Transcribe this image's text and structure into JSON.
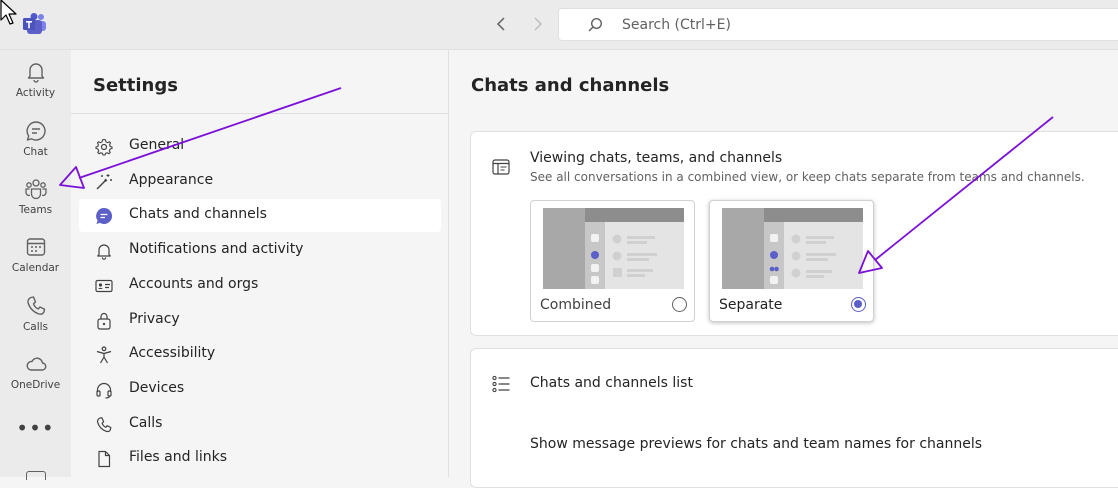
{
  "colors": {
    "accent": "#5b5fc7",
    "annotation": "#7b10d8",
    "rail_bg": "#ebebeb",
    "panel_bg": "#f5f5f5"
  },
  "topbar": {
    "logo_icon": "teams-logo-icon",
    "back_icon": "chevron-left-icon",
    "forward_icon": "chevron-right-icon",
    "search_placeholder": "Search (Ctrl+E)"
  },
  "rail": {
    "items": [
      {
        "label": "Activity",
        "icon": "bell-icon"
      },
      {
        "label": "Chat",
        "icon": "chat-icon"
      },
      {
        "label": "Teams",
        "icon": "teams-icon"
      },
      {
        "label": "Calendar",
        "icon": "calendar-icon"
      },
      {
        "label": "Calls",
        "icon": "phone-icon"
      },
      {
        "label": "OneDrive",
        "icon": "cloud-icon"
      }
    ],
    "more": "•••"
  },
  "settings": {
    "title": "Settings",
    "items": [
      {
        "label": "General",
        "icon": "gear-icon"
      },
      {
        "label": "Appearance",
        "icon": "magic-wand-icon"
      },
      {
        "label": "Chats and channels",
        "icon": "chat-bubble-icon",
        "active": true
      },
      {
        "label": "Notifications and activity",
        "icon": "bell-icon"
      },
      {
        "label": "Accounts and orgs",
        "icon": "contact-card-icon"
      },
      {
        "label": "Privacy",
        "icon": "lock-icon"
      },
      {
        "label": "Accessibility",
        "icon": "accessibility-icon"
      },
      {
        "label": "Devices",
        "icon": "headset-icon"
      },
      {
        "label": "Calls",
        "icon": "phone-icon"
      },
      {
        "label": "Files and links",
        "icon": "document-icon"
      }
    ]
  },
  "main": {
    "title": "Chats and channels",
    "view_card": {
      "title": "Viewing chats, teams, and channels",
      "description": "See all conversations in a combined view, or keep chats separate from teams and channels.",
      "options": [
        {
          "label": "Combined",
          "selected": false
        },
        {
          "label": "Separate",
          "selected": true
        }
      ]
    },
    "list_card": {
      "title": "Chats and channels list",
      "preview_setting": "Show message previews for chats and team names for channels"
    }
  }
}
